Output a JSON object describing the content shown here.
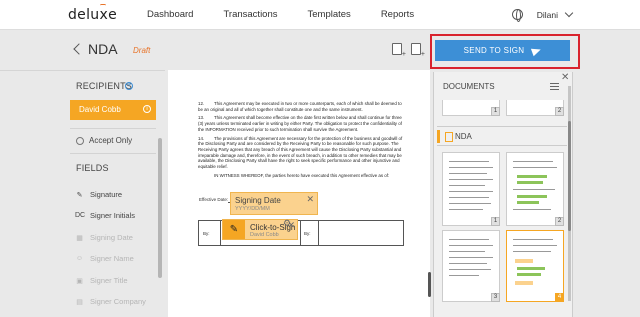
{
  "app": {
    "logo": "deluxe"
  },
  "nav": {
    "links": [
      "Dashboard",
      "Transactions",
      "Templates",
      "Reports"
    ],
    "user_name": "Dilani"
  },
  "header": {
    "title": "NDA",
    "status": "Draft",
    "send_button": "SEND TO SIGN"
  },
  "sidebar": {
    "recipients_label": "RECIPIENTS",
    "recipient": "David Cobb",
    "accept_only": "Accept Only",
    "fields_label": "FIELDS",
    "fields": [
      {
        "icon": "pen-icon",
        "label": "Signature",
        "enabled": true
      },
      {
        "icon": "initials-icon",
        "prefix": "DC",
        "label": "Signer Initials",
        "enabled": true
      },
      {
        "icon": "calendar-icon",
        "label": "Signing Date",
        "enabled": false
      },
      {
        "icon": "person-icon",
        "label": "Signer Name",
        "enabled": false
      },
      {
        "icon": "title-icon",
        "label": "Signer Title",
        "enabled": false
      },
      {
        "icon": "company-icon",
        "label": "Signer Company",
        "enabled": false
      }
    ]
  },
  "document": {
    "paragraphs": [
      {
        "num": "12.",
        "text": "This Agreement may be executed in two or more counterparts, each of which shall be deemed to be an original and all of which together shall constitute one and the same instrument."
      },
      {
        "num": "13.",
        "text": "This Agreement shall become effective on the date first written below and shall continue for three (3) years unless terminated earlier in writing by either Party. The obligation to protect the confidentiality of the INFORMATION received prior to such termination shall survive the Agreement."
      },
      {
        "num": "14.",
        "text": "The provisions of this Agreement are necessary for the protection of the business and goodwill of the Disclosing Party and are considered by the Receiving Party to be reasonable for such purpose. The Receiving Party agrees that any breach of this Agreement will cause the Disclosing Party substantial and irreparable damage and, therefore, in the event of such breach, in addition to other remedies that may be available, the Disclosing Party shall have the right to seek specific performance and other injunctive and equitable relief."
      }
    ],
    "witness": "IN WITNESS WHEREOF, the parties hereto have executed this Agreement effective as of:",
    "effective_label": "Effective Date:",
    "by_label": "By:",
    "date_tag": {
      "title": "Signing Date",
      "placeholder": "YYYY/DD/MM"
    },
    "sign_tag": {
      "title": "Click-to-Sign",
      "signer": "David Cobb"
    }
  },
  "documents_panel": {
    "label": "DOCUMENTS",
    "group_name": "NDA",
    "top_pages": [
      "1",
      "2"
    ],
    "pages": [
      "1",
      "2",
      "3",
      "4"
    ],
    "selected_page": "4"
  },
  "colors": {
    "accent": "#f5a623",
    "primary": "#3d8fd6",
    "highlight": "#d9232d"
  }
}
